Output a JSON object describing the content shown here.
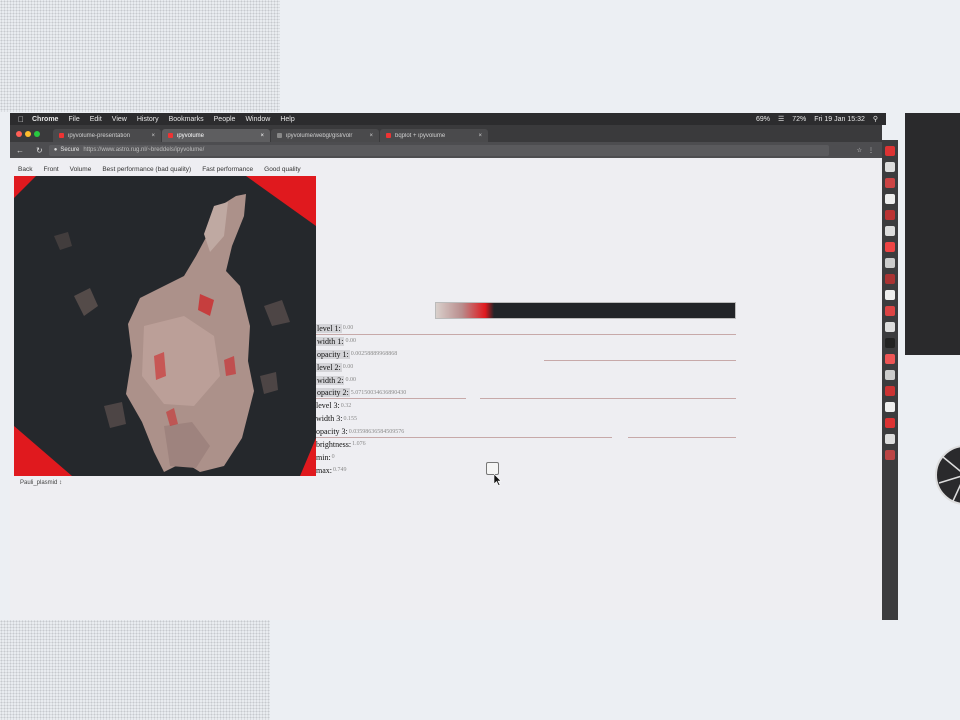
{
  "menubar": {
    "app": "Chrome",
    "items": [
      "File",
      "Edit",
      "View",
      "History",
      "Bookmarks",
      "People",
      "Window",
      "Help"
    ],
    "status_battery": "72%",
    "clock": "Fri 19 Jan 15:32",
    "percent": "69%"
  },
  "tabs": [
    {
      "label": "ipyvolume-presentation",
      "active": false
    },
    {
      "label": "ipyvolume",
      "active": true
    },
    {
      "label": "ipyvolume/webgl/glsl/volr",
      "active": false
    },
    {
      "label": "bqplot + ipyvolume",
      "active": false
    }
  ],
  "address": {
    "secure_label": "Secure",
    "url": "https://www.astro.rug.nl/~breddels/ipyvolume/"
  },
  "toolbar": {
    "buttons": [
      "Back",
      "Front",
      "Volume",
      "Best performance (bad quality)",
      "Fast performance",
      "Good quality"
    ]
  },
  "preset_select": {
    "value": "Pauli_plasmid",
    "arrow": "↕"
  },
  "controls": [
    {
      "label": "level 1:",
      "value": "0.00",
      "boxed": true
    },
    {
      "label": "width 1:",
      "value": "0.00",
      "boxed": true
    },
    {
      "label": "opacity 1:",
      "value": "0.00258889968868",
      "boxed": true
    },
    {
      "label": "level 2:",
      "value": "0.00",
      "boxed": true
    },
    {
      "label": "width 2:",
      "value": "0.00",
      "boxed": true
    },
    {
      "label": "opacity 2:",
      "value": "5.07150034636890430",
      "boxed": true
    },
    {
      "label": "level 3:",
      "value": "0.32",
      "boxed": false
    },
    {
      "label": "width 3:",
      "value": "0.155",
      "boxed": false
    },
    {
      "label": "opacity 3:",
      "value": "0.03598636584509576",
      "boxed": false
    },
    {
      "label": "brightness:",
      "value": "1.076",
      "boxed": false
    },
    {
      "label": "min:",
      "value": "0",
      "boxed": false
    },
    {
      "label": "max:",
      "value": "0.749",
      "boxed": false
    }
  ],
  "colors": {
    "viewer_bg": "#25282c",
    "accent_red": "#e0191e",
    "volume_tone": "#b89a92"
  },
  "icons": [
    "apple-icon",
    "reload-icon",
    "lock-icon",
    "star-icon",
    "checkbox-icon",
    "mouse-cursor-icon"
  ]
}
